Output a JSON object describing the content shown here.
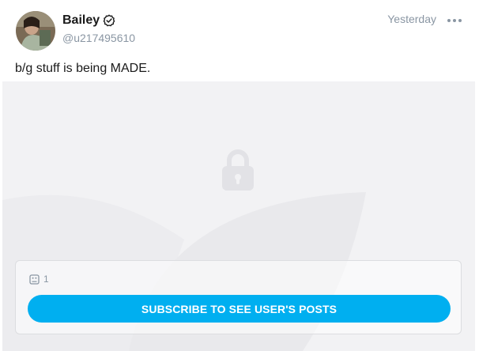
{
  "post": {
    "author": {
      "display_name": "Bailey",
      "username": "@u217495610",
      "verified": true
    },
    "timestamp": "Yesterday",
    "text": "b/g stuff is being MADE.",
    "locked": {
      "media_count": "1",
      "subscribe_label": "SUBSCRIBE TO SEE USER'S POSTS"
    },
    "icons": {
      "verified": "verified-check-icon",
      "more": "more-horizontal-icon",
      "lock": "lock-icon",
      "media": "image-icon"
    },
    "colors": {
      "accent": "#00aff0",
      "muted_text": "#8a96a3",
      "locked_bg": "#f2f2f4"
    }
  }
}
